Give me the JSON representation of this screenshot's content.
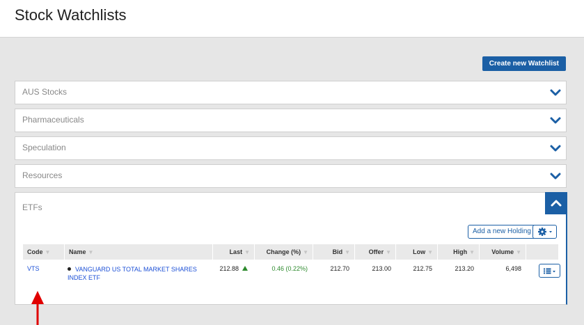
{
  "page": {
    "title": "Stock Watchlists"
  },
  "toolbar": {
    "create_label": "Create new Watchlist"
  },
  "watchlists": [
    {
      "label": "AUS Stocks",
      "expanded": false
    },
    {
      "label": "Pharmaceuticals",
      "expanded": false
    },
    {
      "label": "Speculation",
      "expanded": false
    },
    {
      "label": "Resources",
      "expanded": false
    },
    {
      "label": "ETFs",
      "expanded": true
    }
  ],
  "etfs": {
    "add_holding_label": "Add a new Holding",
    "columns": [
      "Code",
      "Name",
      "Last",
      "Change (%)",
      "Bid",
      "Offer",
      "Low",
      "High",
      "Volume"
    ],
    "rows": [
      {
        "code": "VTS",
        "name_line1": "VANGUARD US TOTAL MARKET SHARES",
        "name_line2": "INDEX ETF",
        "last": "212.88",
        "change": "0.46 (0.22%)",
        "bid": "212.70",
        "offer": "213.00",
        "low": "212.75",
        "high": "213.20",
        "volume": "6,498"
      }
    ]
  },
  "colors": {
    "accent": "#1b5fa5",
    "positive": "#2d8a2d",
    "annotation": "#e00000"
  },
  "icons": [
    "chevron-down-icon",
    "chevron-up-icon",
    "gear-icon",
    "caret-down-icon",
    "list-icon",
    "sort-icon",
    "up-arrow-icon"
  ]
}
